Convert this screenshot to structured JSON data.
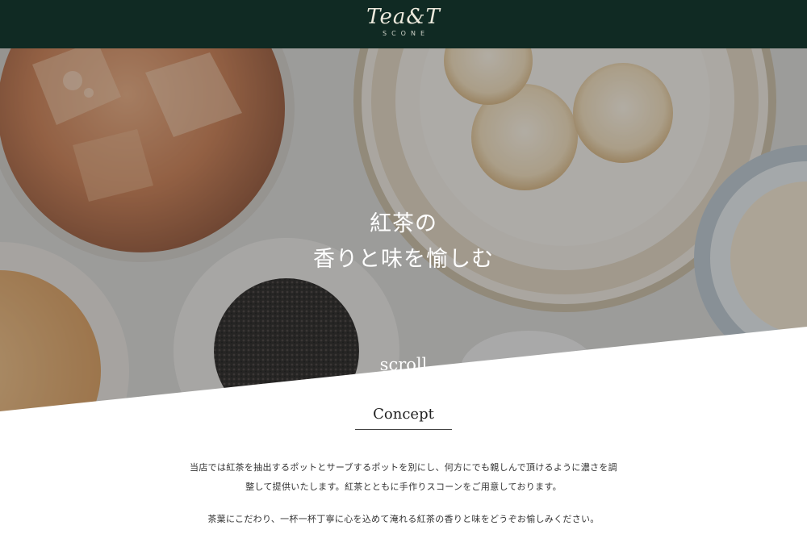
{
  "header": {
    "logo_script": "Tea&T",
    "logo_sub": "SCONE"
  },
  "hero": {
    "title_line1": "紅茶の",
    "title_line2": "香りと味を愉しむ",
    "scroll_label": "scroll"
  },
  "concept": {
    "heading": "Concept",
    "para1_line1": "当店では紅茶を抽出するポットとサーブするポットを別にし、何方にでも親しんで頂けるように濃さを調",
    "para1_line2": "整して提供いたします。紅茶とともに手作りスコーンをご用意しております。",
    "para2": "茶葉にこだわり、一杯一杯丁寧に心を込めて淹れる紅茶の香りと味をどうぞお愉しみください。"
  },
  "colors": {
    "header_bg": "#102a23",
    "hero_overlay": "#3a3a3a"
  }
}
